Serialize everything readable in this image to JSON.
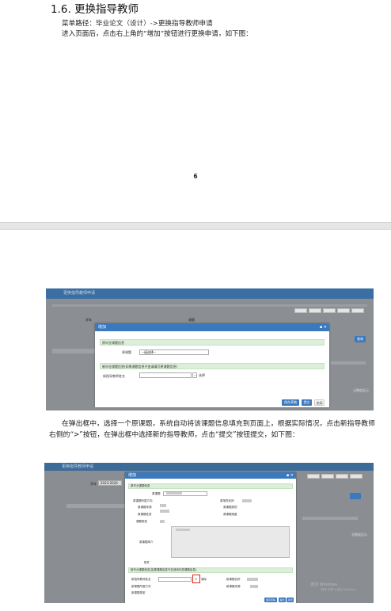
{
  "heading": "1.6. 更换指导教师",
  "menu_path": "菜单路径：毕业论文（设计）->更换指导教师申请",
  "intro": "进入页面后，点击右上角的“增加”按钮进行更换申请，如下图：",
  "page_number": "6",
  "paragraph": "在弹出框中，选择一个原课题，系统自动将该课题信息填充到页面上，根据实际情况，点击新指导教师右侧的“>”按钮，在弹出框中选择新的指导教师，点击“提交”按钮提交，如下图：",
  "screenshot1": {
    "app_title": "更换指导教师申请",
    "toolbar": [
      "增加",
      "修改",
      "删除",
      "查询",
      "刷新"
    ],
    "filter_labels": [
      "学年",
      "课题"
    ],
    "dialog_title": "增加",
    "section1": "原毕业课题信息",
    "field_original_topic": "原课题",
    "select_placeholder": "--请选择--",
    "section2": "新毕业课题信息(如果课题信息不变请填写原课题信息)",
    "field_new_teacher": "新指导教师姓名",
    "pick_button": "选择",
    "buttons": [
      "保存草稿",
      "提交",
      "关闭"
    ],
    "side_button": "查询",
    "footer_text": "无数据显示"
  },
  "screenshot2": {
    "app_title": "更换指导教师申请",
    "dialog_title": "增加",
    "year_label": "学年",
    "year_value": "2023-2024",
    "section1": "原毕业课题信息",
    "labels_left": [
      "原课题",
      "原课题所属方向",
      "原课题来源",
      "原课题性质",
      "课题类型"
    ],
    "labels_right": [
      "原指导老师",
      "原课题类别",
      "原课题难度"
    ],
    "field_desc": "原课题简介",
    "field_note": "附件",
    "section2": "新毕业课题信息(如果课题信息不变请填写原课题信息)",
    "field_new_teacher": "新指导教师姓名",
    "field_new_topic": "新课题名称",
    "field_new_dir": "新课题所属方向",
    "field_new_src": "新课题来源",
    "field_new_type": "新课题类型",
    "pick_symbol": ">",
    "pick_label": "清除",
    "buttons": [
      "保存草稿",
      "提交",
      "关闭"
    ],
    "watermark1": "激活 Windows",
    "watermark2": "转到\"设置\"以激活 Windows。",
    "footer_text": "无数据显示"
  }
}
